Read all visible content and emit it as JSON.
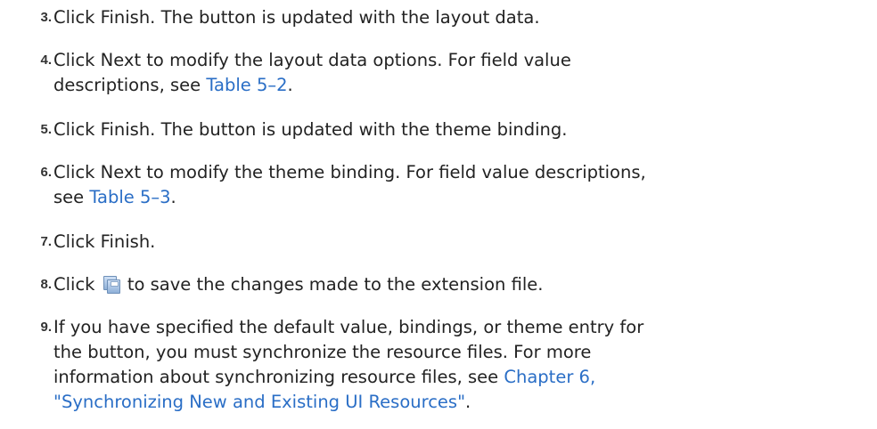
{
  "steps": [
    {
      "number": "3.",
      "segments": [
        "Click Finish. The button is updated with the layout data."
      ]
    },
    {
      "number": "4.",
      "segments": [
        "Click Next to modify the layout data options. For field value",
        "descriptions, see ",
        "Table 5–2",
        "."
      ]
    },
    {
      "number": "5.",
      "segments": [
        "Click Finish. The button is updated with the theme binding."
      ]
    },
    {
      "number": "6.",
      "segments": [
        "Click Next to modify the theme binding. For field value descriptions,",
        "see ",
        "Table 5–3",
        "."
      ]
    },
    {
      "number": "7.",
      "segments": [
        "Click Finish."
      ]
    },
    {
      "number": "8.",
      "segments": [
        "Click ",
        " to save the changes made to the extension file."
      ],
      "icon": "save-all-icon"
    },
    {
      "number": "9.",
      "segments": [
        "If you have specified the default value, bindings, or theme entry for",
        "the button, you must synchronize the resource files. For more",
        "information about synchronizing resource files, see ",
        "Chapter 6,",
        "\"Synchronizing New and Existing UI Resources\"",
        "."
      ]
    }
  ],
  "colors": {
    "text": "#222222",
    "link": "#2a6ec6",
    "number": "#333333"
  }
}
